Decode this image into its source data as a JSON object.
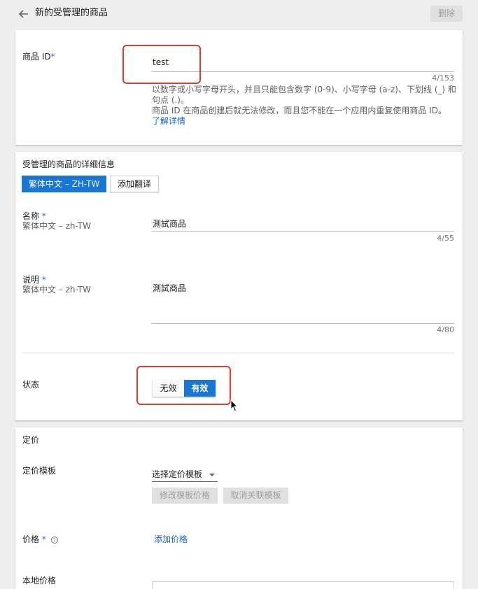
{
  "header": {
    "title": "新的受管理的商品",
    "delete_label": "删除"
  },
  "product_id": {
    "label": "商品 ID",
    "required_mark": "*",
    "value": "test",
    "counter": "4/153",
    "help_line1": "以数字或小写字母开头，并且只能包含数字 (0-9)、小写字母 (a-z)、下划线 (_) 和",
    "help_line2": "句点 (.)。",
    "help_line3": "商品 ID 在商品创建后就无法修改，而且您不能在一个应用内重复使用商品 ID。",
    "learn_more": "了解详情"
  },
  "details": {
    "section_title": "受管理的商品的详细信息",
    "lang_tab_label": "繁体中文",
    "lang_tab_code": " – ZH-TW",
    "add_translation": "添加翻译",
    "name_label": "名称",
    "name_required": "*",
    "name_locale": "繁体中文 – zh-TW",
    "name_value": "測試商品",
    "name_counter": "4/55",
    "desc_label": "说明",
    "desc_required": "*",
    "desc_locale": "繁体中文 – zh-TW",
    "desc_value": "測試商品",
    "desc_counter": "4/80",
    "status_label": "状态",
    "status_off": "无效",
    "status_on": "有效",
    "status_selected": "有效"
  },
  "pricing": {
    "section_title": "定价",
    "template_label": "定价模板",
    "template_select": "选择定价模板",
    "edit_template_price": "修改模板价格",
    "unlink_template": "取消关联模板",
    "price_label": "价格",
    "price_required": "*",
    "help_icon_glyph": "?",
    "add_price": "添加价格",
    "local_price_label": "本地价格"
  },
  "colors": {
    "accent": "#1976d2",
    "highlight": "#e53935",
    "link": "#1565c0"
  }
}
